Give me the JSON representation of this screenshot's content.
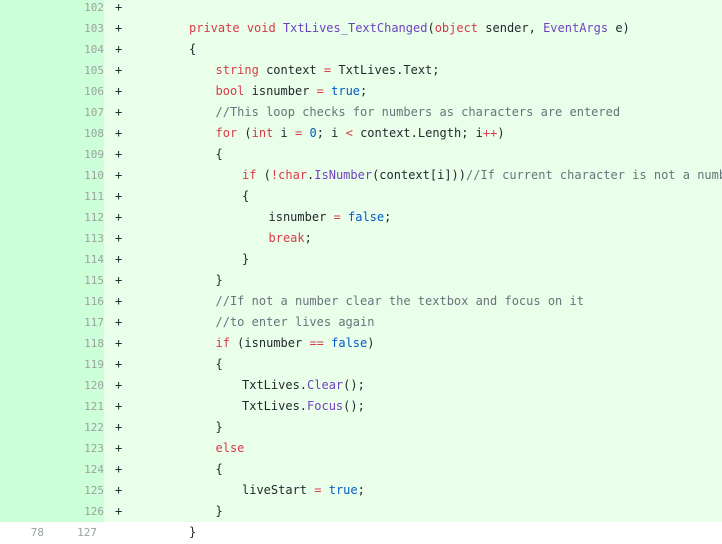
{
  "diff": {
    "lines": [
      {
        "old": "",
        "new": "102",
        "marker": "+",
        "type": "added",
        "indent": 0,
        "tokens": []
      },
      {
        "old": "",
        "new": "103",
        "marker": "+",
        "type": "added",
        "indent": 2,
        "tokens": [
          {
            "t": "private",
            "c": "kw"
          },
          {
            "t": " ",
            "c": ""
          },
          {
            "t": "void",
            "c": "kw"
          },
          {
            "t": " ",
            "c": ""
          },
          {
            "t": "TxtLives_TextChanged",
            "c": "typ"
          },
          {
            "t": "(",
            "c": ""
          },
          {
            "t": "object",
            "c": "kw"
          },
          {
            "t": " sender, ",
            "c": ""
          },
          {
            "t": "EventArgs",
            "c": "typ"
          },
          {
            "t": " e)",
            "c": ""
          }
        ]
      },
      {
        "old": "",
        "new": "104",
        "marker": "+",
        "type": "added",
        "indent": 2,
        "tokens": [
          {
            "t": "{",
            "c": ""
          }
        ]
      },
      {
        "old": "",
        "new": "105",
        "marker": "+",
        "type": "added",
        "indent": 3,
        "tokens": [
          {
            "t": "string",
            "c": "kw"
          },
          {
            "t": " context ",
            "c": ""
          },
          {
            "t": "=",
            "c": "op"
          },
          {
            "t": " TxtLives.Text;",
            "c": ""
          }
        ]
      },
      {
        "old": "",
        "new": "106",
        "marker": "+",
        "type": "added",
        "indent": 3,
        "tokens": [
          {
            "t": "bool",
            "c": "kw"
          },
          {
            "t": " isnumber ",
            "c": ""
          },
          {
            "t": "=",
            "c": "op"
          },
          {
            "t": " ",
            "c": ""
          },
          {
            "t": "true",
            "c": "lit"
          },
          {
            "t": ";",
            "c": ""
          }
        ]
      },
      {
        "old": "",
        "new": "107",
        "marker": "+",
        "type": "added",
        "indent": 3,
        "tokens": [
          {
            "t": "//This loop checks for numbers as characters are entered",
            "c": "com"
          }
        ]
      },
      {
        "old": "",
        "new": "108",
        "marker": "+",
        "type": "added",
        "indent": 3,
        "tokens": [
          {
            "t": "for",
            "c": "kw"
          },
          {
            "t": " (",
            "c": ""
          },
          {
            "t": "int",
            "c": "kw"
          },
          {
            "t": " i ",
            "c": ""
          },
          {
            "t": "=",
            "c": "op"
          },
          {
            "t": " ",
            "c": ""
          },
          {
            "t": "0",
            "c": "num"
          },
          {
            "t": "; i ",
            "c": ""
          },
          {
            "t": "<",
            "c": "op"
          },
          {
            "t": " context.Length; i",
            "c": ""
          },
          {
            "t": "++",
            "c": "op"
          },
          {
            "t": ")",
            "c": ""
          }
        ]
      },
      {
        "old": "",
        "new": "109",
        "marker": "+",
        "type": "added",
        "indent": 3,
        "tokens": [
          {
            "t": "{",
            "c": ""
          }
        ]
      },
      {
        "old": "",
        "new": "110",
        "marker": "+",
        "type": "added",
        "indent": 4,
        "tokens": [
          {
            "t": "if",
            "c": "kw"
          },
          {
            "t": " (",
            "c": ""
          },
          {
            "t": "!",
            "c": "op"
          },
          {
            "t": "char",
            "c": "kw"
          },
          {
            "t": ".",
            "c": ""
          },
          {
            "t": "IsNumber",
            "c": "typ"
          },
          {
            "t": "(context[i]))",
            "c": ""
          },
          {
            "t": "//If current character is not a number",
            "c": "com"
          }
        ]
      },
      {
        "old": "",
        "new": "111",
        "marker": "+",
        "type": "added",
        "indent": 4,
        "tokens": [
          {
            "t": "{",
            "c": ""
          }
        ]
      },
      {
        "old": "",
        "new": "112",
        "marker": "+",
        "type": "added",
        "indent": 5,
        "tokens": [
          {
            "t": "isnumber ",
            "c": ""
          },
          {
            "t": "=",
            "c": "op"
          },
          {
            "t": " ",
            "c": ""
          },
          {
            "t": "false",
            "c": "lit"
          },
          {
            "t": ";",
            "c": ""
          }
        ]
      },
      {
        "old": "",
        "new": "113",
        "marker": "+",
        "type": "added",
        "indent": 5,
        "tokens": [
          {
            "t": "break",
            "c": "kw"
          },
          {
            "t": ";",
            "c": ""
          }
        ]
      },
      {
        "old": "",
        "new": "114",
        "marker": "+",
        "type": "added",
        "indent": 4,
        "tokens": [
          {
            "t": "}",
            "c": ""
          }
        ]
      },
      {
        "old": "",
        "new": "115",
        "marker": "+",
        "type": "added",
        "indent": 3,
        "tokens": [
          {
            "t": "}",
            "c": ""
          }
        ]
      },
      {
        "old": "",
        "new": "116",
        "marker": "+",
        "type": "added",
        "indent": 3,
        "tokens": [
          {
            "t": "//If not a number clear the textbox and focus on it",
            "c": "com"
          }
        ]
      },
      {
        "old": "",
        "new": "117",
        "marker": "+",
        "type": "added",
        "indent": 3,
        "tokens": [
          {
            "t": "//to enter lives again",
            "c": "com"
          }
        ]
      },
      {
        "old": "",
        "new": "118",
        "marker": "+",
        "type": "added",
        "indent": 3,
        "tokens": [
          {
            "t": "if",
            "c": "kw"
          },
          {
            "t": " (isnumber ",
            "c": ""
          },
          {
            "t": "==",
            "c": "op"
          },
          {
            "t": " ",
            "c": ""
          },
          {
            "t": "false",
            "c": "lit"
          },
          {
            "t": ")",
            "c": ""
          }
        ]
      },
      {
        "old": "",
        "new": "119",
        "marker": "+",
        "type": "added",
        "indent": 3,
        "tokens": [
          {
            "t": "{",
            "c": ""
          }
        ]
      },
      {
        "old": "",
        "new": "120",
        "marker": "+",
        "type": "added",
        "indent": 4,
        "tokens": [
          {
            "t": "TxtLives.",
            "c": ""
          },
          {
            "t": "Clear",
            "c": "typ"
          },
          {
            "t": "();",
            "c": ""
          }
        ]
      },
      {
        "old": "",
        "new": "121",
        "marker": "+",
        "type": "added",
        "indent": 4,
        "tokens": [
          {
            "t": "TxtLives.",
            "c": ""
          },
          {
            "t": "Focus",
            "c": "typ"
          },
          {
            "t": "();",
            "c": ""
          }
        ]
      },
      {
        "old": "",
        "new": "122",
        "marker": "+",
        "type": "added",
        "indent": 3,
        "tokens": [
          {
            "t": "}",
            "c": ""
          }
        ]
      },
      {
        "old": "",
        "new": "123",
        "marker": "+",
        "type": "added",
        "indent": 3,
        "tokens": [
          {
            "t": "else",
            "c": "kw"
          }
        ]
      },
      {
        "old": "",
        "new": "124",
        "marker": "+",
        "type": "added",
        "indent": 3,
        "tokens": [
          {
            "t": "{",
            "c": ""
          }
        ]
      },
      {
        "old": "",
        "new": "125",
        "marker": "+",
        "type": "added",
        "indent": 4,
        "tokens": [
          {
            "t": "liveStart ",
            "c": ""
          },
          {
            "t": "=",
            "c": "op"
          },
          {
            "t": " ",
            "c": ""
          },
          {
            "t": "true",
            "c": "lit"
          },
          {
            "t": ";",
            "c": ""
          }
        ]
      },
      {
        "old": "",
        "new": "126",
        "marker": "+",
        "type": "added",
        "indent": 3,
        "tokens": [
          {
            "t": "}",
            "c": ""
          }
        ]
      },
      {
        "old": "78",
        "new": "127",
        "marker": "",
        "type": "context",
        "indent": 2,
        "tokens": [
          {
            "t": "}",
            "c": ""
          }
        ]
      }
    ]
  }
}
